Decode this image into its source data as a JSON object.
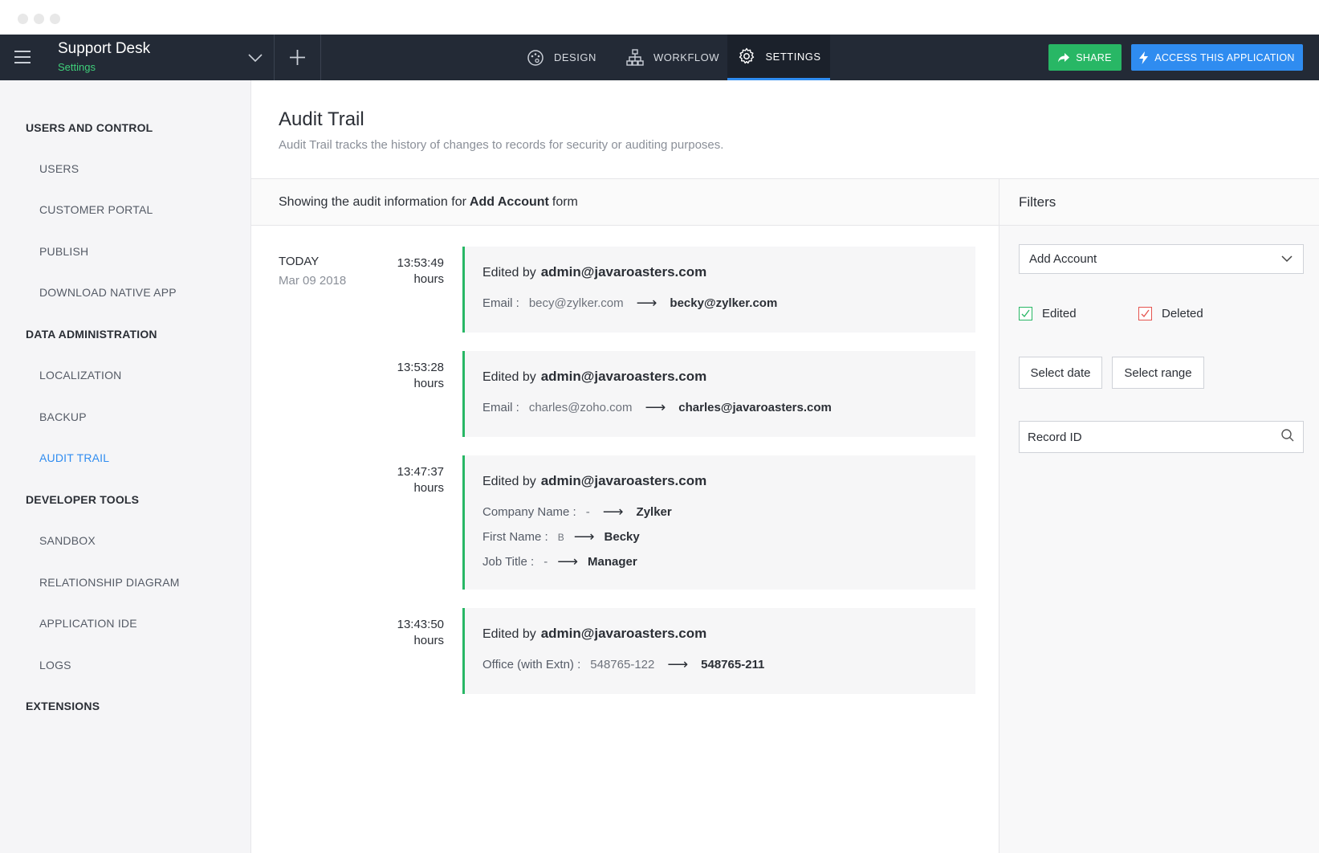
{
  "app": {
    "title": "Support Desk",
    "subtitle": "Settings"
  },
  "nav": {
    "tabs": [
      {
        "label": "DESIGN",
        "icon": "palette-icon"
      },
      {
        "label": "WORKFLOW",
        "icon": "workflow-icon"
      },
      {
        "label": "SETTINGS",
        "icon": "gear-icon",
        "active": true
      }
    ],
    "share_label": "SHARE",
    "access_label": "ACCESS THIS APPLICATION"
  },
  "colors": {
    "topbar": "#232a36",
    "accent_green": "#28b765",
    "accent_blue": "#2f8cf0",
    "deleted_red": "#e5544f"
  },
  "sidebar": {
    "sections": [
      {
        "title": "USERS AND CONTROL",
        "items": [
          "USERS",
          "CUSTOMER PORTAL",
          "PUBLISH",
          "DOWNLOAD NATIVE APP"
        ]
      },
      {
        "title": "DATA ADMINISTRATION",
        "items": [
          "LOCALIZATION",
          "BACKUP",
          "AUDIT TRAIL"
        ]
      },
      {
        "title": "DEVELOPER TOOLS",
        "items": [
          "SANDBOX",
          "RELATIONSHIP DIAGRAM",
          "APPLICATION IDE",
          "LOGS"
        ]
      },
      {
        "title": "EXTENSIONS",
        "items": []
      }
    ],
    "active_item": "AUDIT TRAIL"
  },
  "page": {
    "title": "Audit Trail",
    "description": "Audit Trail tracks the history of changes to records for security or auditing purposes.",
    "showing_prefix": "Showing the audit information for",
    "showing_form": "Add Account",
    "showing_suffix": "form"
  },
  "audit": {
    "day_label": "TODAY",
    "date": "Mar 09 2018",
    "edited_by_prefix": "Edited by",
    "unit": "hours",
    "arrow": "⟶",
    "entries": [
      {
        "time": "13:53:49",
        "user": "admin@javaroasters.com",
        "changes": [
          {
            "field": "Email :",
            "old": "becy@zylker.com",
            "new": "becky@zylker.com"
          }
        ]
      },
      {
        "time": "13:53:28",
        "user": "admin@javaroasters.com",
        "changes": [
          {
            "field": "Email :",
            "old": "charles@zoho.com",
            "new": "charles@javaroasters.com"
          }
        ]
      },
      {
        "time": "13:47:37",
        "user": "admin@javaroasters.com",
        "changes": [
          {
            "field": "Company Name :",
            "old": "-",
            "new": "Zylker"
          },
          {
            "field": "First Name :",
            "old": "B",
            "new": "Becky"
          },
          {
            "field": "Job Title :",
            "old": "-",
            "new": "Manager"
          }
        ]
      },
      {
        "time": "13:43:50",
        "user": "admin@javaroasters.com",
        "changes": [
          {
            "field": "Office (with Extn) :",
            "old": "548765-122",
            "new": "548765-211"
          }
        ]
      }
    ]
  },
  "filters": {
    "title": "Filters",
    "form_select": "Add Account",
    "edited_label": "Edited",
    "deleted_label": "Deleted",
    "select_date": "Select date",
    "select_range": "Select range",
    "record_id_placeholder": "Record ID"
  }
}
